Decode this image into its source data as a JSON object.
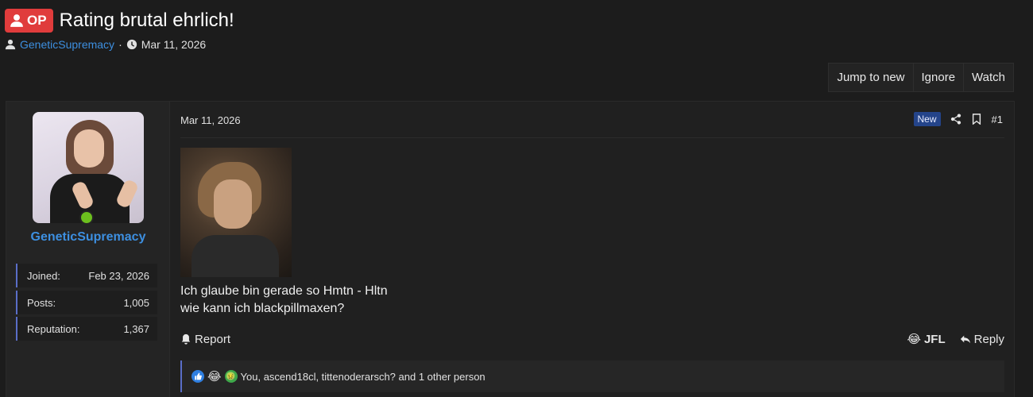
{
  "thread": {
    "op_badge": "OP",
    "title": "Rating brutal ehrlich!",
    "author": "GeneticSupremacy",
    "separator": "·",
    "date": "Mar 11, 2026"
  },
  "actions": {
    "jump_to_new": "Jump to new",
    "ignore": "Ignore",
    "watch": "Watch"
  },
  "user": {
    "name": "GeneticSupremacy",
    "online": true,
    "stats": [
      {
        "label": "Joined:",
        "value": "Feb 23, 2026"
      },
      {
        "label": "Posts:",
        "value": "1,005"
      },
      {
        "label": "Reputation:",
        "value": "1,367"
      }
    ]
  },
  "post": {
    "date": "Mar 11, 2026",
    "new_badge": "New",
    "number": "#1",
    "text_line1": "Ich glaube bin gerade so Hmtn - Hltn",
    "text_line2": "wie kann ich blackpillmaxen?",
    "report": "Report",
    "jfl": "JFL",
    "reply": "Reply",
    "reactions_text": "You, ascend18cl, tittenoderarsch? and 1 other person"
  },
  "colors": {
    "accent_blue": "#3d8fe0",
    "op_red": "#e03c3c",
    "online_green": "#6cbf1e",
    "bar_purple": "#5a6ec8"
  }
}
